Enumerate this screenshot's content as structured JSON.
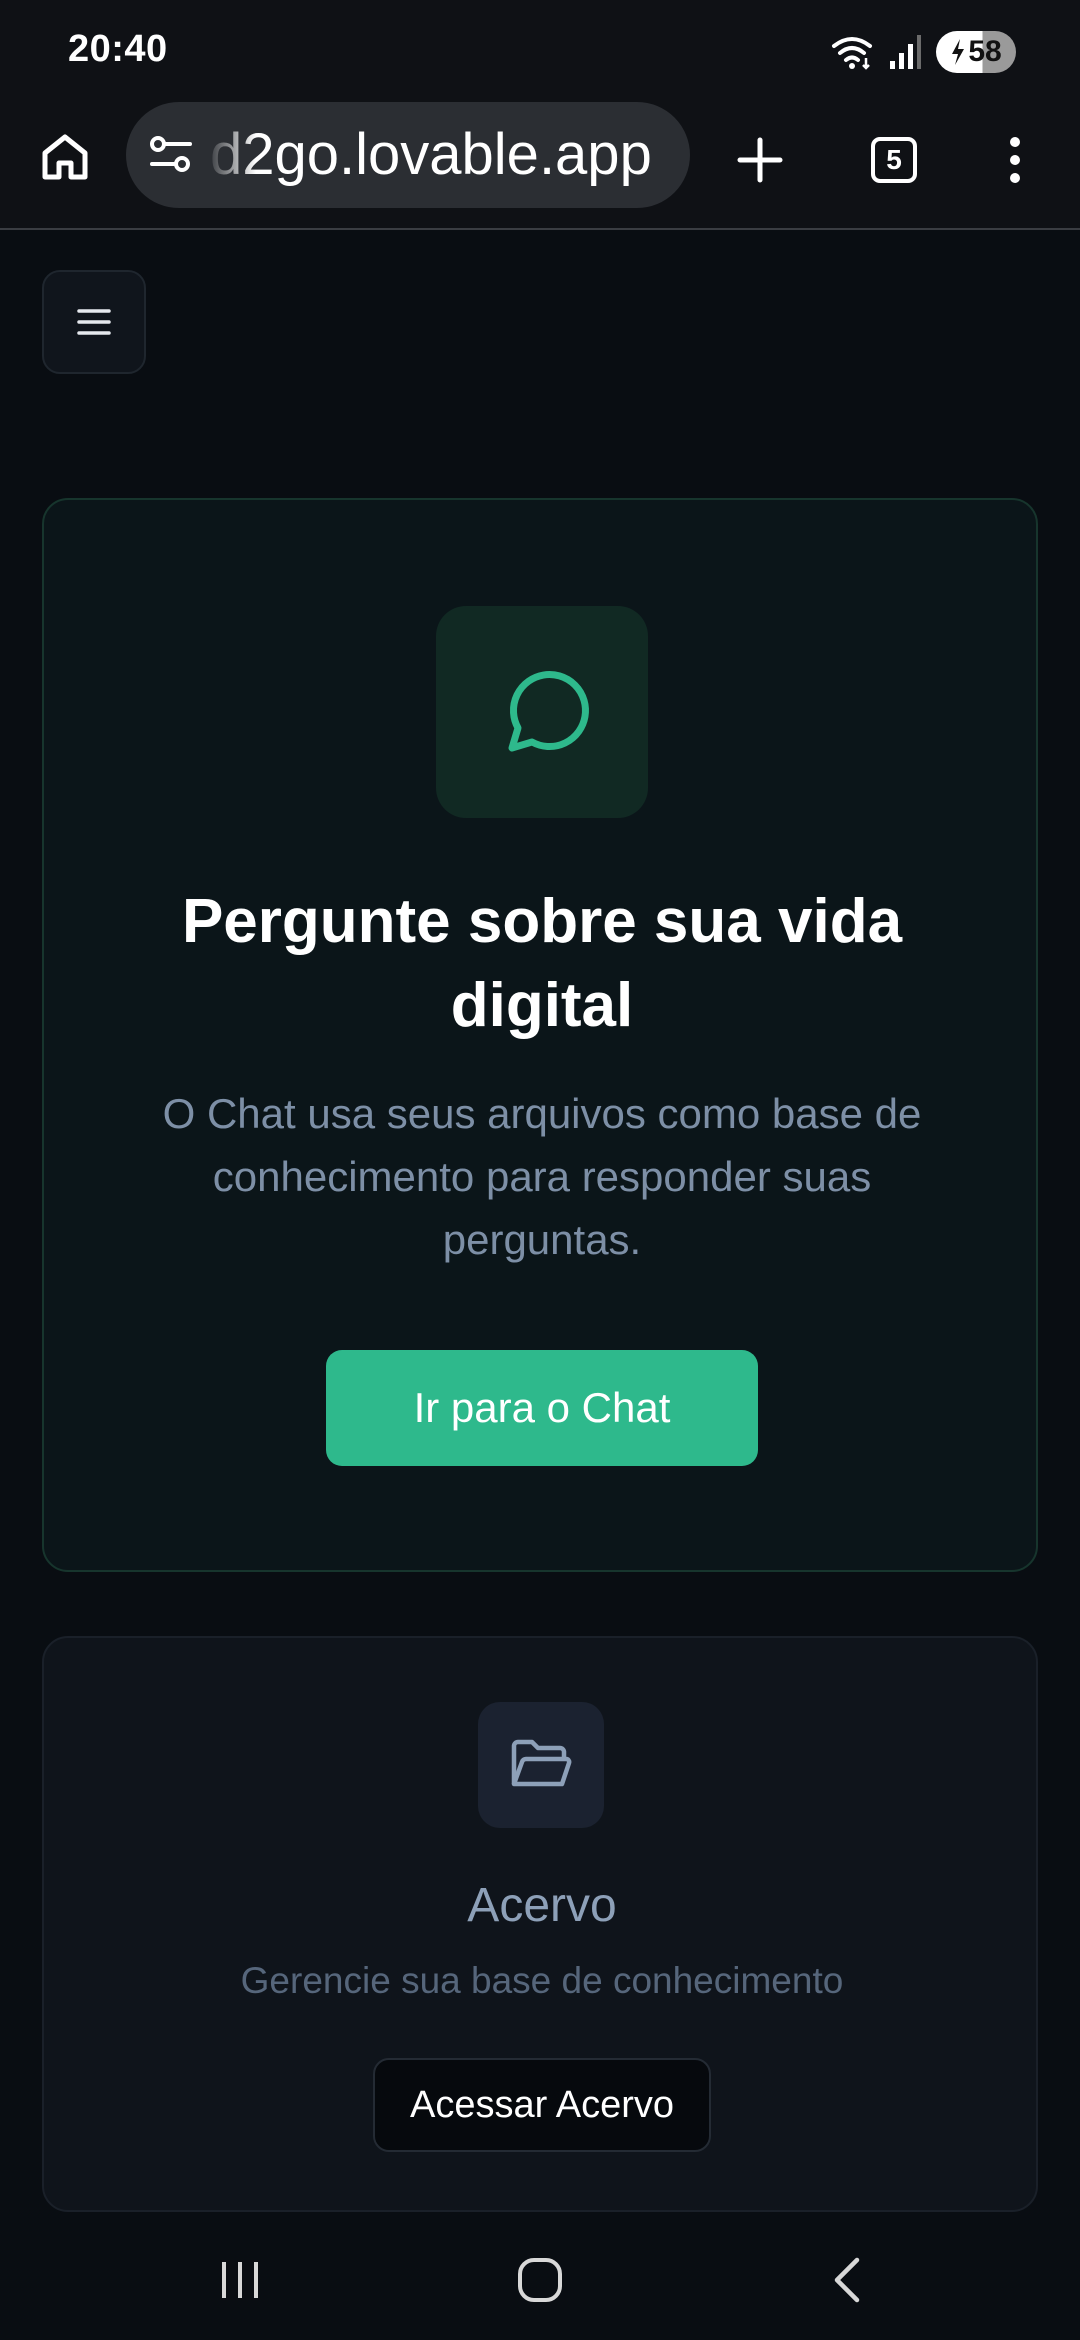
{
  "status_bar": {
    "time": "20:40",
    "battery_level": "58",
    "icons": [
      "wifi-icon",
      "signal-icon",
      "battery-charging-icon"
    ]
  },
  "browser": {
    "url": "d2go.lovable.app",
    "tab_count": "5",
    "icons": [
      "home-icon",
      "site-settings-icon",
      "new-tab-icon",
      "tabs-icon",
      "more-icon"
    ]
  },
  "main": {
    "menu_icon": "hamburger-menu-icon",
    "hero": {
      "icon": "chat-bubble-icon",
      "title": "Pergunte sobre sua vida digital",
      "description": "O Chat usa seus arquivos como base de conhecimento para responder suas perguntas.",
      "button_label": "Ir para o Chat"
    },
    "acervo": {
      "icon": "folder-open-icon",
      "title": "Acervo",
      "description": "Gerencie sua base de conhecimento",
      "button_label": "Acessar Acervo"
    }
  },
  "nav_bar": {
    "icons": [
      "recent-apps-icon",
      "home-nav-icon",
      "back-icon"
    ]
  },
  "colors": {
    "background": "#090d12",
    "accent": "#2eb98c",
    "hero_card_bg": "#0b1519",
    "muted_text": "#7d8fa6"
  }
}
